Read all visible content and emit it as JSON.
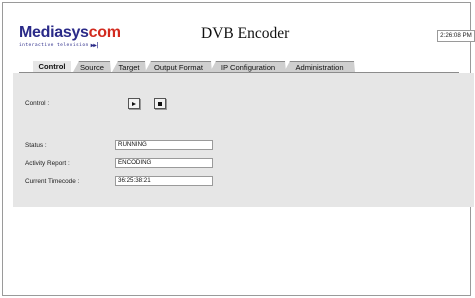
{
  "brand": {
    "logo_part1": "Mediasys",
    "logo_part2": "com",
    "tagline": "interactive television",
    "tagline_icon": "fast-forward-icon"
  },
  "header": {
    "title": "DVB Encoder",
    "clock": "2:26:08 PM"
  },
  "tabs": [
    {
      "label": "Control",
      "active": true
    },
    {
      "label": "Source"
    },
    {
      "label": "Target"
    },
    {
      "label": "Output Format"
    },
    {
      "label": "IP Configuration"
    },
    {
      "label": "Administration"
    }
  ],
  "control": {
    "label": "Control :",
    "play_icon": "play-icon",
    "stop_icon": "stop-icon"
  },
  "status": {
    "status_label": "Status :",
    "status_value": "RUNNING",
    "activity_label": "Activity Report :",
    "activity_value": "ENCODING",
    "timecode_label": "Current Timecode :",
    "timecode_value": "36:25:38:21"
  },
  "colors": {
    "panel": "#e6e6e6",
    "tab": "#cfcfcf",
    "logo_blue": "#2a2a88",
    "logo_red": "#d22a1e"
  }
}
